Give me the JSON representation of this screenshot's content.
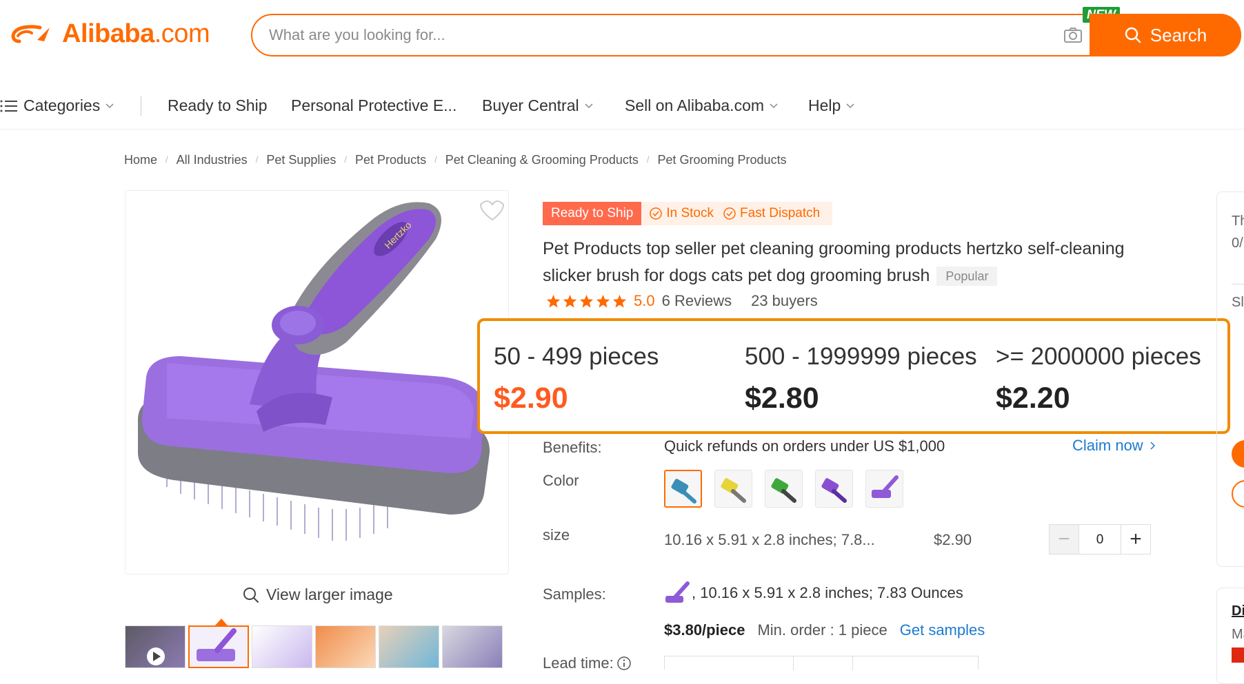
{
  "header": {
    "logo_text": "Alibaba",
    "logo_domain": ".com",
    "search_placeholder": "What are you looking for...",
    "search_button": "Search",
    "new_badge": "NEW"
  },
  "nav": {
    "categories": "Categories",
    "items": [
      "Ready to Ship",
      "Personal Protective E...",
      "Buyer Central",
      "Sell on Alibaba.com",
      "Help"
    ]
  },
  "breadcrumb": [
    "Home",
    "All Industries",
    "Pet Supplies",
    "Pet Products",
    "Pet Cleaning & Grooming Products",
    "Pet Grooming Products"
  ],
  "gallery": {
    "view_larger": "View larger image",
    "brand_text": "Hertzko"
  },
  "product": {
    "tag_ready": "Ready to Ship",
    "tag_in_stock": "In Stock",
    "tag_fast_dispatch": "Fast Dispatch",
    "title": "Pet Products top seller pet cleaning grooming products hertzko self-cleaning slicker brush for dogs cats pet dog grooming brush",
    "popular": "Popular",
    "rating": "5.0",
    "reviews": "6 Reviews",
    "buyers": "23 buyers",
    "stars": 5
  },
  "pricing": [
    {
      "qty": "50 - 499 pieces",
      "price": "$2.90"
    },
    {
      "qty": "500 - 1999999 pieces",
      "price": "$2.80"
    },
    {
      "qty": ">= 2000000 pieces",
      "price": "$2.20"
    }
  ],
  "benefits": {
    "label": "Benefits:",
    "text": "Quick refunds on orders under US $1,000",
    "claim": "Claim now"
  },
  "color": {
    "label": "Color",
    "swatches": [
      "#3a8fb8",
      "#e6d43a",
      "#3fa83a",
      "#8a4fd0",
      "#8e5ad6"
    ]
  },
  "size": {
    "label": "size",
    "text": "10.16 x 5.91 x 2.8 inches; 7.8...",
    "price": "$2.90",
    "quantity": "0"
  },
  "samples": {
    "label": "Samples:",
    "text": ", 10.16 x 5.91 x 2.8 inches; 7.83 Ounces",
    "price": "$3.80/piece",
    "min_order": "Min. order : 1 piece",
    "get_samples": "Get samples"
  },
  "lead_time": {
    "label": "Lead time:"
  },
  "rail": {
    "t1": "Th",
    "t2": "0/",
    "t3": "Sl",
    "t4": "Di",
    "t5": "Ma"
  },
  "colors": {
    "accent": "#ff6a00",
    "price_highlight": "#ff5a1f",
    "link": "#1d7ad1",
    "badge_new": "#1f9d36"
  }
}
